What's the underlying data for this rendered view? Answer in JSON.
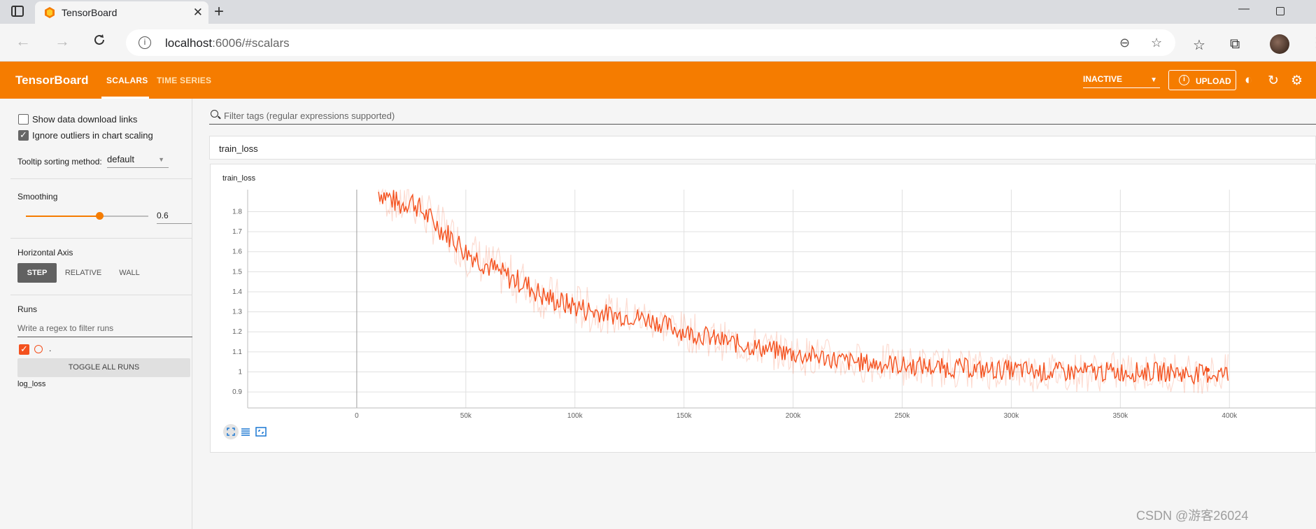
{
  "browser": {
    "tab_title": "TensorBoard",
    "url_host": "localhost",
    "url_rest": ":6006/#scalars"
  },
  "header": {
    "brand": "TensorBoard",
    "tabs": [
      {
        "label": "SCALARS",
        "active": true
      },
      {
        "label": "TIME SERIES",
        "active": false
      }
    ],
    "status_select": "INACTIVE",
    "upload_label": "UPLOAD",
    "accent_color": "#f57c00"
  },
  "sidebar": {
    "show_download_links": {
      "label": "Show data download links",
      "checked": false
    },
    "ignore_outliers": {
      "label": "Ignore outliers in chart scaling",
      "checked": true
    },
    "tooltip_sorting_label": "Tooltip sorting method:",
    "tooltip_sorting_value": "default",
    "smoothing_label": "Smoothing",
    "smoothing_value": "0.6",
    "horizontal_axis_label": "Horizontal Axis",
    "axis_options": [
      "STEP",
      "RELATIVE",
      "WALL"
    ],
    "axis_selected": "STEP",
    "runs_label": "Runs",
    "runs_filter_placeholder": "Write a regex to filter runs",
    "run_name": ".",
    "toggle_all_label": "TOGGLE ALL RUNS",
    "log_dir": "log_loss"
  },
  "main": {
    "filter_placeholder": "Filter tags (regular expressions supported)",
    "group_title": "train_loss",
    "card_title": "train_loss"
  },
  "watermark": "CSDN @游客26024",
  "chart_data": {
    "type": "line",
    "title": "train_loss",
    "xlabel": "",
    "ylabel": "",
    "xlim": [
      -50000,
      440000
    ],
    "ylim": [
      0.82,
      1.91
    ],
    "x_ticks": [
      "0",
      "50k",
      "100k",
      "150k",
      "200k",
      "250k",
      "300k",
      "350k",
      "400k"
    ],
    "y_ticks": [
      "0.9",
      "1",
      "1.1",
      "1.2",
      "1.3",
      "1.4",
      "1.5",
      "1.6",
      "1.7",
      "1.8"
    ],
    "grid": true,
    "series": [
      {
        "smoothed": true,
        "color": "#f4511e",
        "x_step": 5000,
        "x_start": 10000,
        "y": [
          1.9,
          1.87,
          1.83,
          1.86,
          1.8,
          1.75,
          1.7,
          1.66,
          1.6,
          1.57,
          1.53,
          1.5,
          1.47,
          1.45,
          1.42,
          1.38,
          1.36,
          1.34,
          1.33,
          1.31,
          1.3,
          1.29,
          1.28,
          1.28,
          1.27,
          1.26,
          1.24,
          1.22,
          1.2,
          1.19,
          1.18,
          1.16,
          1.15,
          1.14,
          1.13,
          1.12,
          1.11,
          1.1,
          1.09,
          1.08,
          1.08,
          1.07,
          1.06,
          1.05,
          1.05,
          1.04,
          1.04,
          1.04,
          1.03,
          1.03,
          1.03,
          1.02,
          1.02,
          1.02,
          1.02,
          1.01,
          1.01,
          1.01,
          1.01,
          1.01,
          1.0,
          1.0,
          1.0,
          1.0,
          1.0,
          1.0,
          1.0,
          1.0,
          1.0,
          1.0,
          1.0,
          1.0,
          1.0,
          1.0,
          0.99,
          0.99,
          0.99,
          0.99,
          0.99
        ],
        "last_point": [
          390000,
          1.01
        ]
      }
    ]
  }
}
